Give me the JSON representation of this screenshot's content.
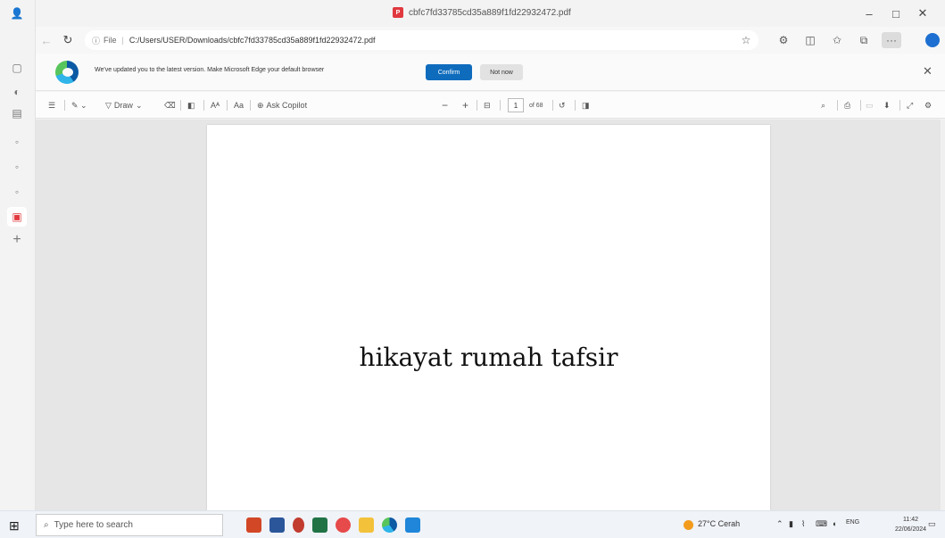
{
  "browser": {
    "tab_title": "cbfc7fd33785cd35a889f1fd22932472.pdf",
    "address": {
      "scheme_label": "File",
      "url": "C:/Users/USER/Downloads/cbfc7fd33785cd35a889f1fd22932472.pdf"
    }
  },
  "infobar": {
    "message": "We've updated you to the latest version. Make Microsoft Edge your default browser",
    "confirm_label": "Confirm",
    "not_now_label": "Not now"
  },
  "pdf_toolbar": {
    "draw_label": "Draw",
    "ask_copilot_label": "Ask Copilot",
    "page_number": "1",
    "page_total": "of 68"
  },
  "document": {
    "text": "hikayat rumah tafsir"
  },
  "taskbar": {
    "search_placeholder": "Type here to search",
    "weather": "27°C Cerah",
    "language": "ENG",
    "time": "11:42",
    "date": "22/06/2024"
  },
  "colors": {
    "accent": "#0f6cbd",
    "pdf_red": "#e0393e"
  }
}
